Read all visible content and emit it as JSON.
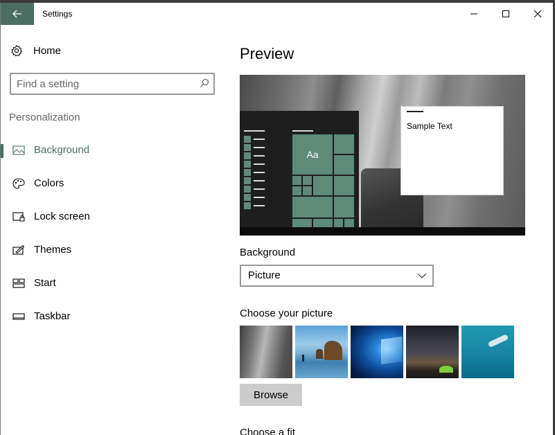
{
  "window": {
    "title": "Settings"
  },
  "sidebar": {
    "home_label": "Home",
    "search_placeholder": "Find a setting",
    "section_label": "Personalization",
    "items": [
      {
        "label": "Background",
        "icon": "picture-icon",
        "active": true
      },
      {
        "label": "Colors",
        "icon": "palette-icon",
        "active": false
      },
      {
        "label": "Lock screen",
        "icon": "lock-screen-icon",
        "active": false
      },
      {
        "label": "Themes",
        "icon": "themes-icon",
        "active": false
      },
      {
        "label": "Start",
        "icon": "start-icon",
        "active": false
      },
      {
        "label": "Taskbar",
        "icon": "taskbar-icon",
        "active": false
      }
    ]
  },
  "main": {
    "preview_title": "Preview",
    "preview": {
      "tile_label": "Aa",
      "sample_text": "Sample Text"
    },
    "background_label": "Background",
    "background_value": "Picture",
    "choose_picture_label": "Choose your picture",
    "pictures": [
      "rock-cliff",
      "sea-arch-beach",
      "windows-hero",
      "milky-way-tent",
      "underwater-diver"
    ],
    "browse_label": "Browse",
    "choose_fit_label": "Choose a fit"
  },
  "colors": {
    "accent": "#4c6d62",
    "tile": "#5e8a7a"
  }
}
